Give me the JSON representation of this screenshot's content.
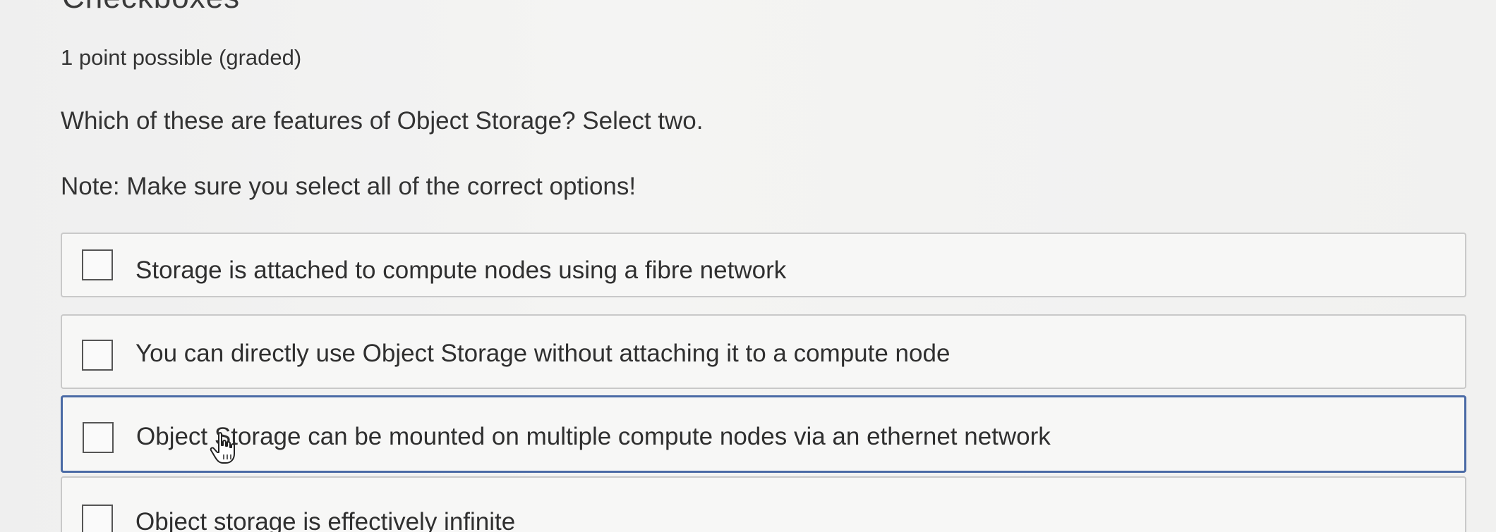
{
  "problem": {
    "heading": "Checkboxes",
    "points": "1 point possible (graded)",
    "question": "Which of these are features of Object Storage? Select two.",
    "note": "Note: Make sure you select all of the correct options!"
  },
  "options": [
    {
      "label": "Storage is attached to compute nodes using a fibre network",
      "checked": false
    },
    {
      "label": "You can directly use Object Storage without attaching it to a compute node",
      "checked": false
    },
    {
      "label": "Object Storage can be mounted on multiple compute nodes via an ethernet network",
      "checked": false
    },
    {
      "label": "Object storage is effectively infinite",
      "checked": false
    }
  ],
  "colors": {
    "hover_border": "#4a6aa5",
    "default_border": "#c9c9c9",
    "text": "#333333"
  },
  "cursor": "hand-pointer-icon"
}
